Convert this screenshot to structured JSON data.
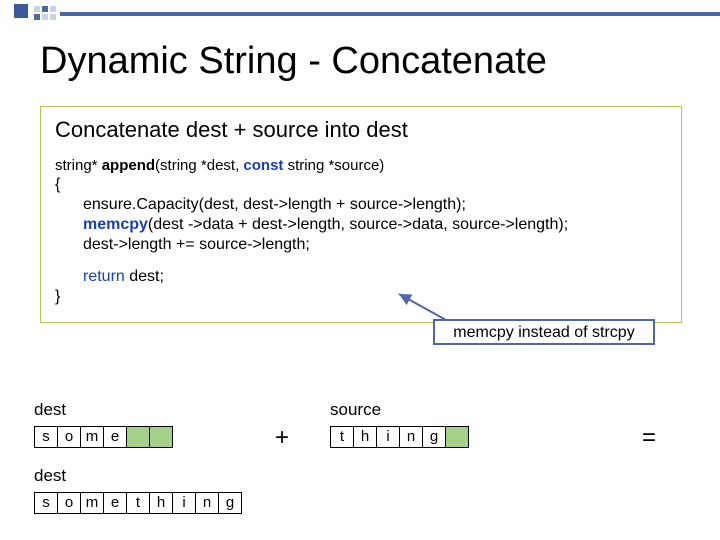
{
  "title": "Dynamic String - Concatenate",
  "subtitle": "Concatenate dest + source into dest",
  "sig": {
    "ret": "string*",
    "fn": "append",
    "open": "(string *dest, ",
    "kw": "const",
    "after": " string *source)"
  },
  "code": {
    "open_brace": "{",
    "l1": "ensure.Capacity(dest, dest->length + source->length);",
    "l2a": "memcpy",
    "l2b": "(dest ->data + dest->length, source->data, source->length);",
    "l3": "dest->length += source->length;",
    "ret_kw": "return",
    "ret_rest": " dest;",
    "close_brace": "}"
  },
  "callout": "memcpy instead of strcpy",
  "labels": {
    "dest": "dest",
    "source": "source",
    "plus": "+",
    "eq": "="
  },
  "rows": {
    "dest1": [
      "s",
      "o",
      "m",
      "e",
      "",
      ""
    ],
    "source": [
      "t",
      "h",
      "i",
      "n",
      "g",
      ""
    ],
    "dest2": [
      "s",
      "o",
      "m",
      "e",
      "t",
      "h",
      "i",
      "n",
      "g"
    ]
  },
  "row_green": {
    "dest1_start": 4,
    "source_start": 5,
    "dest2_start": 99
  }
}
